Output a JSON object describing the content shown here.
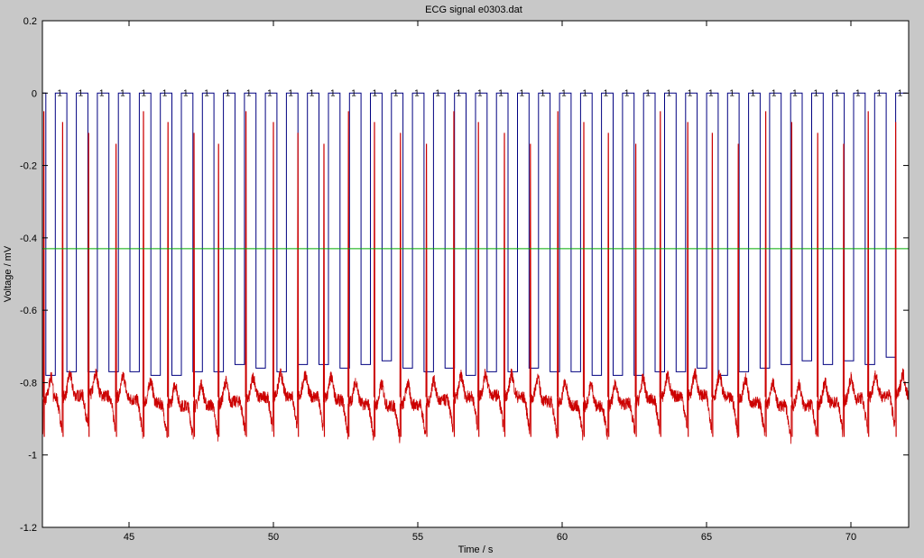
{
  "chart_data": {
    "type": "line",
    "title": "ECG signal e0303.dat",
    "xlabel": "Time / s",
    "ylabel": "Voltage / mV",
    "xlim": [
      42,
      72
    ],
    "ylim": [
      -1.2,
      0.2
    ],
    "x_ticks": [
      "45",
      "50",
      "55",
      "60",
      "65",
      "70"
    ],
    "y_ticks": [
      "-1.2",
      "-1",
      "-0.8",
      "-0.6",
      "-0.4",
      "-0.2",
      "0",
      "0.2"
    ],
    "grid": false,
    "legend": "none",
    "square_wave": {
      "high": 0.0,
      "low_values": [
        -0.78,
        -0.77,
        -0.77,
        -0.77,
        -0.77,
        -0.78,
        -0.78,
        -0.77,
        -0.77,
        -0.75,
        -0.76,
        -0.77,
        -0.75,
        -0.75,
        -0.76,
        -0.75,
        -0.74,
        -0.76,
        -0.77,
        -0.76,
        -0.78,
        -0.77,
        -0.77,
        -0.76,
        -0.77,
        -0.77,
        -0.78,
        -0.78,
        -0.78,
        -0.77,
        -0.77,
        -0.76,
        -0.78,
        -0.77,
        -0.76,
        -0.75,
        -0.74,
        -0.75,
        -0.74,
        -0.75,
        -0.73
      ]
    },
    "beat_times": [
      42.05,
      42.7,
      43.6,
      44.55,
      45.5,
      46.35,
      47.25,
      48.1,
      49.05,
      50.0,
      50.85,
      51.75,
      52.6,
      53.5,
      54.4,
      55.3,
      56.25,
      57.1,
      58.0,
      58.9,
      59.85,
      60.75,
      61.6,
      62.55,
      63.4,
      64.35,
      65.2,
      66.1,
      67.05,
      67.95,
      68.85,
      69.75,
      70.6,
      71.55
    ],
    "threshold": -0.43,
    "beat_labels": [
      "1",
      "1",
      "1",
      "1",
      "1",
      "1",
      "1",
      "1",
      "1",
      "1",
      "1",
      "1",
      "1",
      "1",
      "1",
      "1",
      "1",
      "1",
      "1",
      "1",
      "1",
      "1",
      "1",
      "1",
      "1",
      "1",
      "1",
      "1",
      "1",
      "1",
      "1",
      "1",
      "1",
      "1"
    ],
    "series": [
      {
        "color": "#000080",
        "style": "square wave"
      },
      {
        "color": "#cc0000",
        "style": "ecg trace"
      },
      {
        "color": "#00aa00",
        "style": "horizontal line"
      }
    ]
  }
}
